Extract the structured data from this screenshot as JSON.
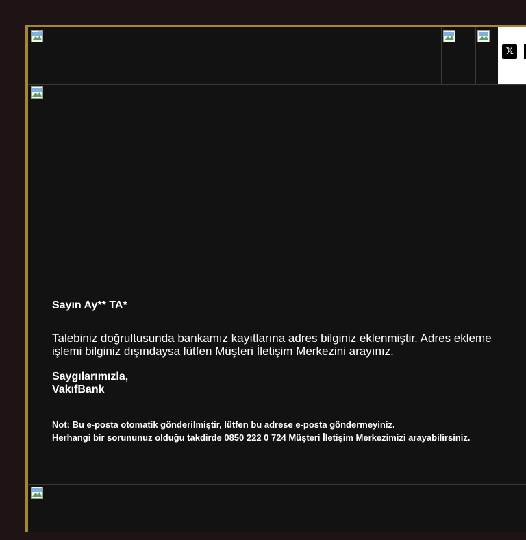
{
  "header": {
    "social_icon": "x-icon",
    "social_label": "𝕏"
  },
  "email": {
    "greeting": "Sayın Ay** TA*",
    "message_line1": "Talebiniz doğrultusunda bankamız kayıtlarına adres bilginiz eklenmiştir. Adres ekleme",
    "message_line2": "işlemi bilginiz dışındaysa lütfen Müşteri İletişim Merkezini arayınız.",
    "closing_line1": "Saygılarımızla,",
    "closing_line2": "VakıfBank",
    "note_line1": "Not: Bu e-posta otomatik gönderilmiştir, lütfen bu adrese e-posta göndermeyiniz.",
    "note_line2": "Herhangi bir sorununuz olduğu takdirde 0850 222 0 724 Müşteri İletişim Merkezimizi arayabilirsiniz."
  },
  "colors": {
    "page_background": "#1f1414",
    "frame_border": "#a88630",
    "content_background": "#121212",
    "text": "#ffffff"
  }
}
